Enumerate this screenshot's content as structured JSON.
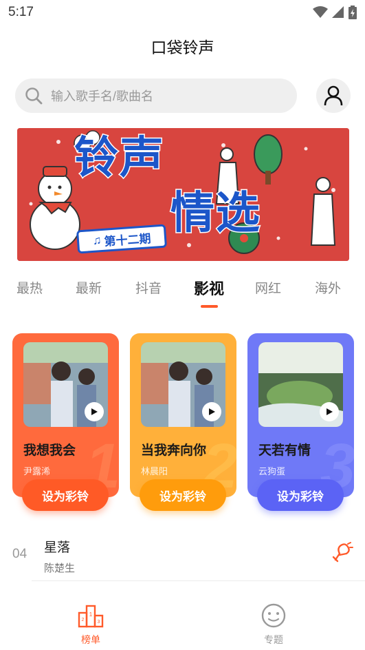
{
  "status_bar": {
    "time": "5:17"
  },
  "header": {
    "title": "口袋铃声"
  },
  "search": {
    "placeholder": "输入歌手名/歌曲名"
  },
  "banner": {
    "title_line1": "铃声",
    "title_line2": "情选",
    "issue_label": "第十二期",
    "dots": 5,
    "active_dot": 3
  },
  "tabs": [
    "最热",
    "最新",
    "抖音",
    "影视",
    "网红",
    "海外"
  ],
  "active_tab": 3,
  "cards": [
    {
      "rank": "1",
      "song": "我想我会",
      "artist": "尹露浠",
      "button": "设为彩铃",
      "bg": "#ff6a3d",
      "button_bg": "#ff5a26",
      "rank_color": "#ff8a5a"
    },
    {
      "rank": "2",
      "song": "当我奔向你",
      "artist": "林晨阳",
      "button": "设为彩铃",
      "bg": "#ffb03a",
      "button_bg": "#ff9c0c",
      "rank_color": "#ffc85a"
    },
    {
      "rank": "3",
      "song": "天若有情",
      "artist": "云狗蛋",
      "button": "设为彩铃",
      "bg": "#6f79f7",
      "button_bg": "#5b63f5",
      "rank_color": "#8b95ff"
    }
  ],
  "list": [
    {
      "index": "04",
      "song": "星落",
      "artist": "陈楚生"
    }
  ],
  "bottom_nav": [
    {
      "label": "榜单",
      "active": true,
      "color": "#ff5a2a"
    },
    {
      "label": "专题",
      "active": false,
      "color": "#999999"
    }
  ],
  "colors": {
    "accent": "#ff5a2a",
    "banner_red": "#d8453f",
    "banner_blue": "#1c56c9"
  }
}
